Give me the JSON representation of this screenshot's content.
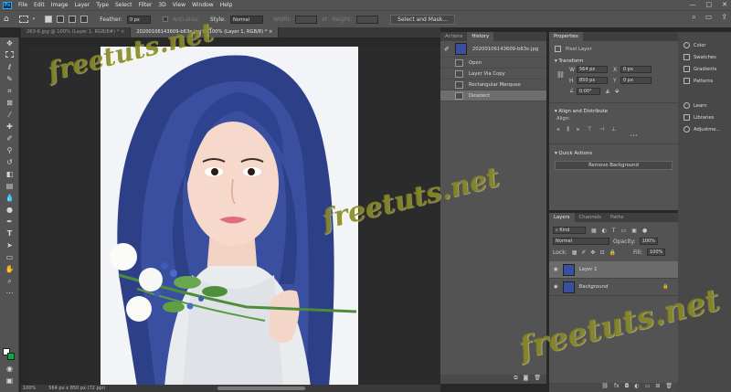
{
  "menubar": {
    "logo": "Ps",
    "items": [
      "File",
      "Edit",
      "Image",
      "Layer",
      "Type",
      "Select",
      "Filter",
      "3D",
      "View",
      "Window",
      "Help"
    ],
    "controls": [
      "—",
      "□",
      "✕"
    ]
  },
  "options": {
    "feather_label": "Feather:",
    "feather_value": "0 px",
    "antialias_label": "Anti-alias",
    "style_label": "Style:",
    "style_value": "Normal",
    "width_label": "Width:",
    "height_label": "Height:",
    "select_mask": "Select and Mask..."
  },
  "tabs": [
    {
      "label": "263-6.jpg @ 100% (Layer 1, RGB/8#) *",
      "close": "×"
    },
    {
      "label": "20200106143609-b63e.jpg @ 100% (Layer 1, RGB/8) *",
      "close": "×"
    }
  ],
  "status": {
    "zoom": "100%",
    "size": "564 px x 850 px (72 ppi)"
  },
  "history": {
    "tabs": [
      "Actions",
      "History"
    ],
    "snapshot": "20200106143609-b63e.jpg",
    "items": [
      "Open",
      "Layer Via Copy",
      "Rectangular Marquee",
      "Deselect"
    ],
    "selected_index": 3
  },
  "properties": {
    "tab": "Properties",
    "type": "Pixel Layer",
    "transform_title": "Transform",
    "w_label": "W",
    "w_value": "564 px",
    "h_label": "H",
    "h_value": "850 px",
    "x_label": "X",
    "x_value": "0 px",
    "y_label": "Y",
    "y_value": "0 px",
    "angle_value": "0.00°",
    "align_title": "Align and Distribute",
    "align_label": "Align:",
    "more": "•••",
    "quick_title": "Quick Actions",
    "remove_bg": "Remove Background"
  },
  "layers": {
    "tabs": [
      "Layers",
      "Channels",
      "Paths"
    ],
    "kind": "Kind",
    "blend_mode": "Normal",
    "opacity_label": "Opacity:",
    "opacity_value": "100%",
    "lock_label": "Lock:",
    "fill_label": "Fill:",
    "fill_value": "100%",
    "items": [
      {
        "name": "Layer 1",
        "selected": true
      },
      {
        "name": "Background",
        "selected": false
      }
    ]
  },
  "rightstrip": {
    "group1": [
      "Color",
      "Swatches",
      "Gradients",
      "Patterns"
    ],
    "group2": [
      "Learn",
      "Libraries",
      "Adjustme..."
    ]
  },
  "watermark": "freetuts.net",
  "colors": {
    "foreground": "#ffffff",
    "background": "#00b140",
    "accent": "#31a8ff"
  }
}
